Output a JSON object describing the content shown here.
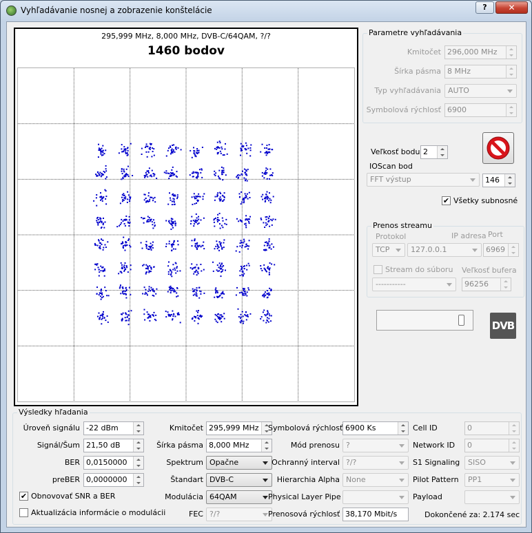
{
  "window": {
    "title": "Vyhľadávanie nosnej a zobrazenie konštelácie",
    "help_label": "?",
    "close_label": "✕"
  },
  "plot": {
    "subtitle": "295,999 MHz, 8,000 MHz, DVB-C/64QAM, ?/?",
    "title": "1460 bodov",
    "dot_color": "#0000cc"
  },
  "search_params": {
    "title": "Parametre vyhľadávania",
    "frequency_label": "Kmitočet",
    "frequency_value": "296,000 MHz",
    "bandwidth_label": "Šírka pásma",
    "bandwidth_value": "8 MHz",
    "search_type_label": "Typ vyhľadávania",
    "search_type_value": "AUTO",
    "symbol_rate_label": "Symbolová rýchlosť",
    "symbol_rate_value": "6900"
  },
  "point_size": {
    "label": "Veľkosť bodu",
    "value": "2"
  },
  "ioscan": {
    "label": "IOScan bod",
    "mode_value": "FFT výstup",
    "point_value": "146",
    "all_subcarriers_label": "Všetky subnosné",
    "all_subcarriers_checked": true
  },
  "stream": {
    "title": "Prenos streamu",
    "protocol_label": "Protokol",
    "ip_label": "IP adresa",
    "port_label": "Port",
    "protocol_value": "TCP",
    "ip_value": "127.0.0.1",
    "port_value": "6969",
    "to_file_label": "Stream do súboru",
    "buffer_label": "Veľkosť bufera",
    "file_value": "-----------",
    "buffer_value": "96256"
  },
  "logo_text": "DVB",
  "results": {
    "title": "Výsledky hľadania",
    "signal_level_label": "Úroveň signálu",
    "signal_level_value": "-22 dBm",
    "snr_label": "Signál/Šum",
    "snr_value": "21,50 dB",
    "ber_label": "BER",
    "ber_value": "0,0150000",
    "preber_label": "preBER",
    "preber_value": "0,0000000",
    "refresh_snr_label": "Obnovovať SNR a BER",
    "refresh_snr_checked": true,
    "update_mod_label": "Aktualizácia informácie o modulácii",
    "update_mod_checked": false,
    "freq_label": "Kmitočet",
    "freq_value": "295,999 MHz",
    "bw_label": "Šírka pásma",
    "bw_value": "8,000 MHz",
    "spectrum_label": "Spektrum",
    "spectrum_value": "Opačne",
    "standard_label": "Štandart",
    "standard_value": "DVB-C",
    "modulation_label": "Modulácia",
    "modulation_value": "64QAM",
    "fec_label": "FEC",
    "fec_value": "?/?",
    "sr_label": "Symbolová rýchlosť",
    "sr_value": "6900 Ks",
    "mode_label": "Mód prenosu",
    "mode_value": "?",
    "guard_label": "Ochranný interval",
    "guard_value": "?/?",
    "hierarchy_label": "Hierarchia Alpha",
    "hierarchy_value": "None",
    "plp_label": "Physical Layer Pipe",
    "plp_value": "",
    "bitrate_label": "Prenosová rýchlosť",
    "bitrate_value": "38,170 Mbit/s",
    "cell_label": "Cell ID",
    "cell_value": "0",
    "network_label": "Network ID",
    "network_value": "0",
    "s1_label": "S1 Signaling",
    "s1_value": "SISO",
    "pilot_label": "Pilot Pattern",
    "pilot_value": "PP1",
    "payload_label": "Payload",
    "payload_value": "",
    "done_label": "Dokončené za: 2.174 sec"
  }
}
